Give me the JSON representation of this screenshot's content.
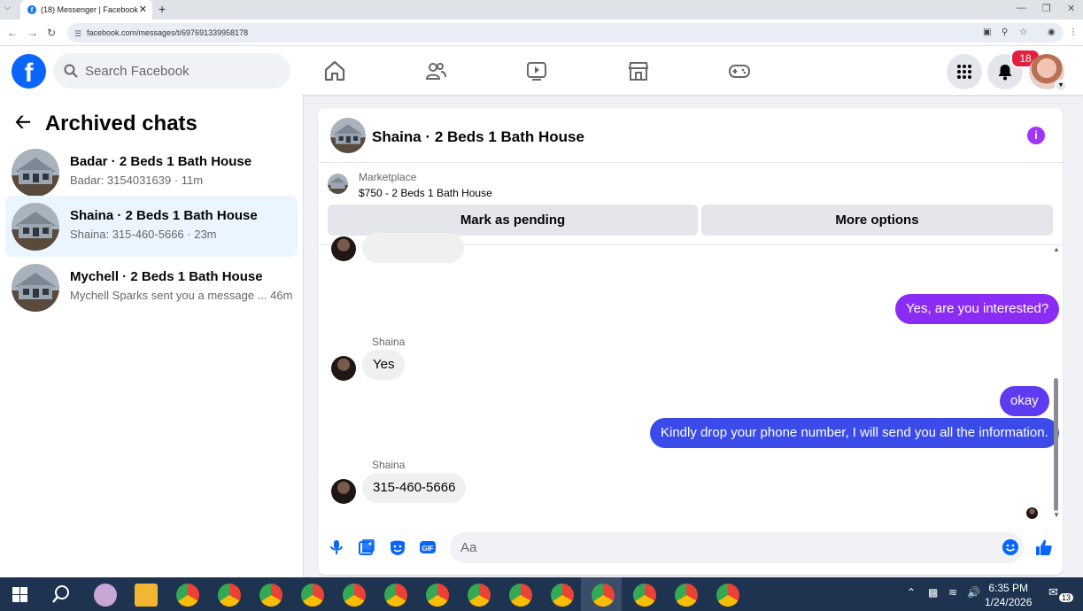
{
  "browser": {
    "tab_title": "(18) Messenger | Facebook",
    "new_tab": "+",
    "url": "facebook.com/messages/t/697691339958178"
  },
  "header": {
    "search_placeholder": "Search Facebook",
    "notification_count": "18",
    "colors": {
      "brand": "#0866ff",
      "badge": "#e41e3f"
    }
  },
  "sidebar": {
    "title": "Archived chats",
    "chats": [
      {
        "title": "Badar · 2 Beds 1 Bath House",
        "subtitle": "Badar: 3154031639 · 11m"
      },
      {
        "title": "Shaina · 2 Beds 1 Bath House",
        "subtitle": "Shaina: 315-460-5666 · 23m",
        "active": true
      },
      {
        "title": "Mychell · 2 Beds 1 Bath House",
        "subtitle": "Mychell Sparks sent you a message ...  46m"
      }
    ]
  },
  "conversation": {
    "title": "Shaina · 2 Beds 1 Bath House",
    "marketplace": {
      "label": "Marketplace",
      "item": "$750 - 2 Beds 1 Bath House",
      "mark_pending": "Mark as pending",
      "more_options": "More options"
    },
    "messages": [
      {
        "sender": "",
        "text": "Yes, are you interested?",
        "direction": "out"
      },
      {
        "sender": "Shaina",
        "text": "Yes",
        "direction": "in"
      },
      {
        "sender": "",
        "text": "okay",
        "direction": "out"
      },
      {
        "sender": "",
        "text": "Kindly drop your phone number, I will send you all the information.",
        "direction": "out"
      },
      {
        "sender": "Shaina",
        "text": "315-460-5666",
        "direction": "in"
      }
    ],
    "composer_placeholder": "Aa",
    "colors": {
      "outgoing_top": "#8b2cf5",
      "outgoing_bottom": "#3b4bea",
      "accent": "#0866ff"
    }
  },
  "taskbar": {
    "time": "6:35 PM",
    "date": "1/24/2026",
    "notification_count": "13"
  }
}
